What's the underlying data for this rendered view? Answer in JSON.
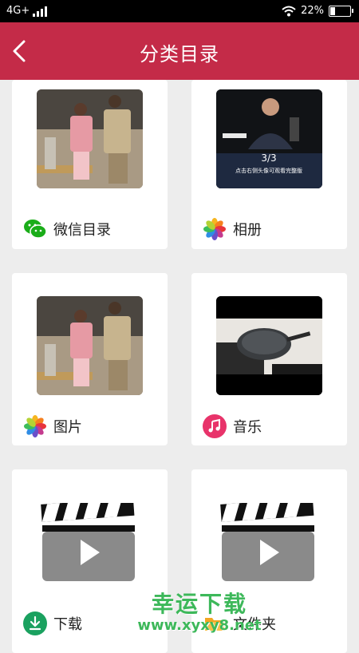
{
  "status_bar": {
    "network": "4G+",
    "battery": "22%",
    "battery_level": 0.22
  },
  "header": {
    "title": "分类目录"
  },
  "thumbs": {
    "video_caption_page": "3/3",
    "video_caption_text": "点击右侧头像可观看完整版"
  },
  "categories": [
    {
      "label": "微信目录",
      "icon": "wechat-icon"
    },
    {
      "label": "相册",
      "icon": "photos-icon"
    },
    {
      "label": "图片",
      "icon": "photos-icon"
    },
    {
      "label": "音乐",
      "icon": "music-icon"
    },
    {
      "label": "下载",
      "icon": "download-icon"
    },
    {
      "label": "文件夹",
      "icon": "folder-icon"
    }
  ],
  "watermark": {
    "line1": "幸运下载",
    "line2": "www.xyxy8.net"
  },
  "colors": {
    "header": "#c42b48",
    "background": "#ededed",
    "accent_green": "#3db85a",
    "music": "#e8336a",
    "download": "#1aa15f"
  }
}
